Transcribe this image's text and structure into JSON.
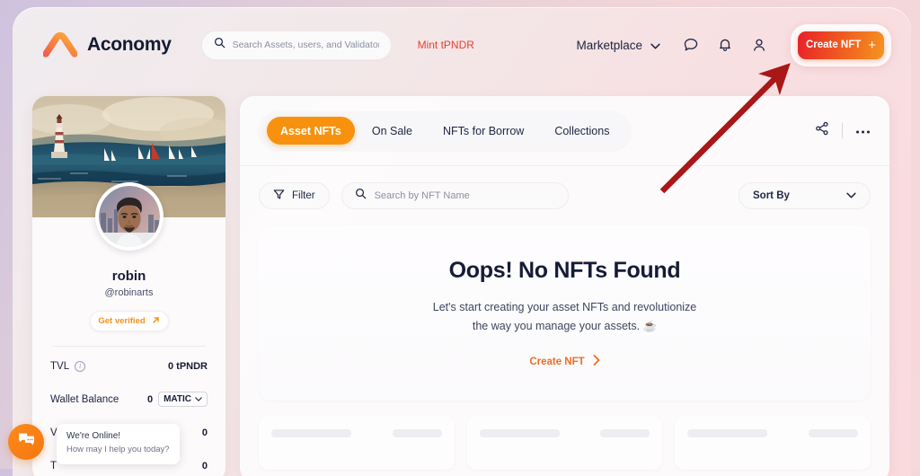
{
  "header": {
    "brand": "Aconomy",
    "logo_icon": "aconomy-logo-icon",
    "search": {
      "placeholder": "Search Assets, users, and Validators",
      "value": "",
      "icon": "search-icon"
    },
    "mint_link": "Mint tPNDR",
    "marketplace": "Marketplace",
    "marketplace_chevron": "chevron-down-icon",
    "chat_icon": "chat-bubble-icon",
    "bell_icon": "notification-bell-icon",
    "account_icon": "user-account-icon",
    "create_nft": "Create NFT",
    "create_nft_plus": "plus-icon"
  },
  "sidebar": {
    "banner_alt": "seascape-painting-banner",
    "avatar_alt": "user-avatar-portrait",
    "name": "robin",
    "handle": "@robinarts",
    "verify_label": "Get verified",
    "verify_icon": "arrow-up-right-icon",
    "stats": [
      {
        "label": "TVL",
        "value": "0 tPNDR",
        "has_info": true
      },
      {
        "label": "Wallet Balance",
        "value": "0",
        "token": "MATIC",
        "has_select": true
      },
      {
        "label": "Validated Assets",
        "value": "0",
        "has_info": false
      },
      {
        "label": "T",
        "value": "0",
        "has_info": false
      }
    ]
  },
  "main": {
    "tabs": [
      {
        "label": "Asset NFTs",
        "active": true
      },
      {
        "label": "On Sale",
        "active": false
      },
      {
        "label": "NFTs for Borrow",
        "active": false
      },
      {
        "label": "Collections",
        "active": false
      }
    ],
    "share_icon": "share-icon",
    "more_icon": "more-horizontal-icon",
    "filter_label": "Filter",
    "filter_icon": "filter-funnel-icon",
    "nft_search": {
      "placeholder": "Search by NFT Name",
      "value": "",
      "icon": "search-icon"
    },
    "sort_by": "Sort By",
    "sort_chevron": "chevron-down-icon",
    "empty": {
      "title": "Oops! No NFTs Found",
      "subtitle_line1": "Let's start creating your asset NFTs and revolutionize",
      "subtitle_line2": "the way you manage your assets. ☕",
      "cta": "Create NFT",
      "cta_icon": "chevron-right-icon"
    }
  },
  "chat": {
    "icon": "chat-widget-icon",
    "title": "We're Online!",
    "subtitle": "How may I help you today?"
  },
  "annotation": {
    "type": "arrow",
    "points_to": "create-nft-button",
    "color": "#a91717"
  },
  "colors": {
    "accent_orange": "#f8920e",
    "cta_red": "#e8202a",
    "cta_orange": "#f5941f",
    "mint_red": "#e8412f",
    "dark_navy": "#161c36",
    "annotation_red": "#a91717"
  }
}
